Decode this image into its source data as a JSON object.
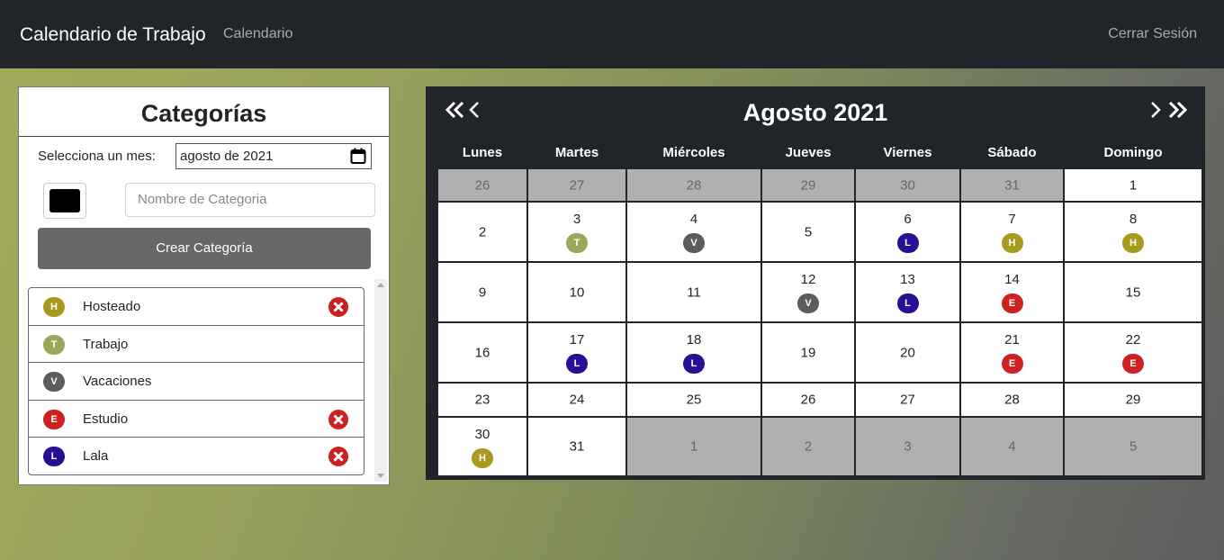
{
  "navbar": {
    "brand": "Calendario de Trabajo",
    "link_calendar": "Calendario",
    "logout": "Cerrar Sesión"
  },
  "categories_panel": {
    "title": "Categorías",
    "month_label": "Selecciona un mes:",
    "month_value": "agosto de 2021",
    "color_value": "#000000",
    "name_placeholder": "Nombre de Categoria",
    "create_button": "Crear Categoría",
    "items": [
      {
        "letter": "H",
        "name": "Hosteado",
        "color": "#a89a1e",
        "deletable": true
      },
      {
        "letter": "T",
        "name": "Trabajo",
        "color": "#9aa85c",
        "deletable": false
      },
      {
        "letter": "V",
        "name": "Vacaciones",
        "color": "#5c5c5c",
        "deletable": false
      },
      {
        "letter": "E",
        "name": "Estudio",
        "color": "#cc2222",
        "deletable": true
      },
      {
        "letter": "L",
        "name": "Lala",
        "color": "#2a0f94",
        "deletable": true
      }
    ]
  },
  "calendar": {
    "title": "Agosto 2021",
    "weekdays": [
      "Lunes",
      "Martes",
      "Miércoles",
      "Jueves",
      "Viernes",
      "Sábado",
      "Domingo"
    ],
    "weeks": [
      [
        {
          "d": "26",
          "o": true
        },
        {
          "d": "27",
          "o": true
        },
        {
          "d": "28",
          "o": true
        },
        {
          "d": "29",
          "o": true
        },
        {
          "d": "30",
          "o": true
        },
        {
          "d": "31",
          "o": true
        },
        {
          "d": "1"
        }
      ],
      [
        {
          "d": "2"
        },
        {
          "d": "3",
          "e": "T"
        },
        {
          "d": "4",
          "e": "V"
        },
        {
          "d": "5"
        },
        {
          "d": "6",
          "e": "L"
        },
        {
          "d": "7",
          "e": "H"
        },
        {
          "d": "8",
          "e": "H"
        }
      ],
      [
        {
          "d": "9"
        },
        {
          "d": "10"
        },
        {
          "d": "11"
        },
        {
          "d": "12",
          "e": "V"
        },
        {
          "d": "13",
          "e": "L"
        },
        {
          "d": "14",
          "e": "E"
        },
        {
          "d": "15"
        }
      ],
      [
        {
          "d": "16"
        },
        {
          "d": "17",
          "e": "L"
        },
        {
          "d": "18",
          "e": "L"
        },
        {
          "d": "19"
        },
        {
          "d": "20"
        },
        {
          "d": "21",
          "e": "E"
        },
        {
          "d": "22",
          "e": "E"
        }
      ],
      [
        {
          "d": "23"
        },
        {
          "d": "24"
        },
        {
          "d": "25"
        },
        {
          "d": "26"
        },
        {
          "d": "27"
        },
        {
          "d": "28"
        },
        {
          "d": "29"
        }
      ],
      [
        {
          "d": "30",
          "e": "H"
        },
        {
          "d": "31"
        },
        {
          "d": "1",
          "o": true
        },
        {
          "d": "2",
          "o": true
        },
        {
          "d": "3",
          "o": true
        },
        {
          "d": "4",
          "o": true
        },
        {
          "d": "5",
          "o": true
        }
      ]
    ]
  }
}
